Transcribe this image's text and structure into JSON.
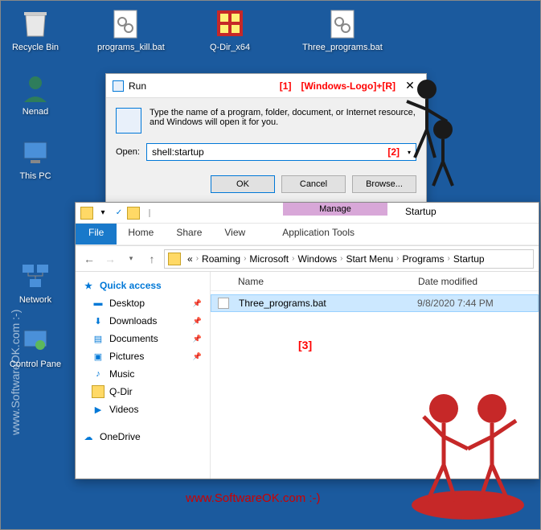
{
  "desktop_icons": {
    "recycle": "Recycle Bin",
    "programs_kill": "programs_kill.bat",
    "qdir": "Q-Dir_x64",
    "three_programs": "Three_programs.bat",
    "nenad": "Nenad",
    "thispc": "This PC",
    "network": "Network",
    "controlpanel": "Control Pane"
  },
  "run_dialog": {
    "title": "Run",
    "annotation1": "[1]",
    "shortcut_label": "[Windows-Logo]+[R]",
    "message": "Type the name of a program, folder, document, or Internet resource, and Windows will open it for you.",
    "open_label": "Open:",
    "input_value": "shell:startup",
    "annotation2": "[2]",
    "ok": "OK",
    "cancel": "Cancel",
    "browse": "Browse..."
  },
  "explorer": {
    "tabs": {
      "file": "File",
      "home": "Home",
      "share": "Share",
      "view": "View",
      "apptools": "Application Tools",
      "manage": "Manage",
      "startup": "Startup"
    },
    "breadcrumb": [
      "«",
      "Roaming",
      "Microsoft",
      "Windows",
      "Start Menu",
      "Programs",
      "Startup"
    ],
    "cols": {
      "name": "Name",
      "date": "Date modified"
    },
    "sidebar": {
      "quick_access": "Quick access",
      "desktop": "Desktop",
      "downloads": "Downloads",
      "documents": "Documents",
      "pictures": "Pictures",
      "music": "Music",
      "qdir": "Q-Dir",
      "videos": "Videos",
      "onedrive": "OneDrive"
    },
    "row": {
      "name": "Three_programs.bat",
      "date": "9/8/2020 7:44 PM"
    },
    "annotation3": "[3]"
  },
  "watermark": {
    "vert": "www.SoftwareOK.com :-)",
    "horiz": "www.SoftwareOK.com :-)"
  }
}
